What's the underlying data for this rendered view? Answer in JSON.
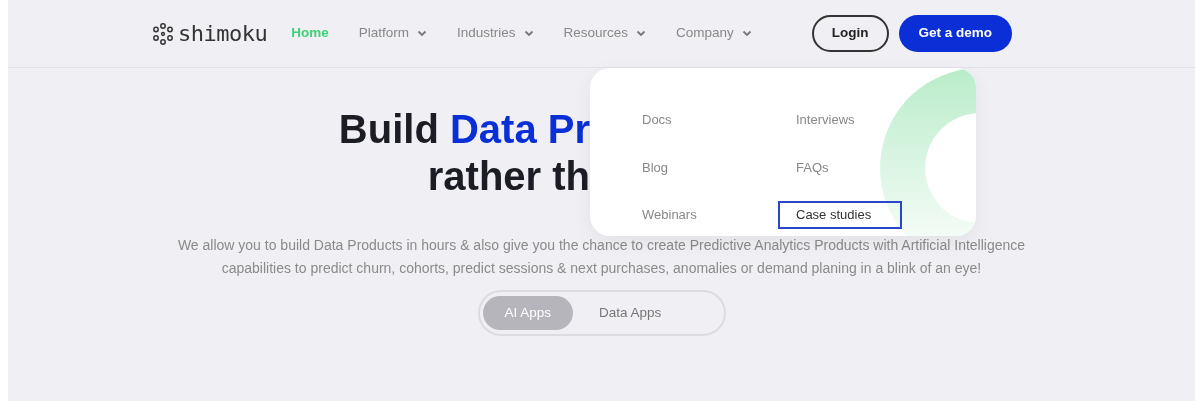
{
  "logo": {
    "text": "shimoku"
  },
  "nav": {
    "items": [
      {
        "label": "Home",
        "selected": true,
        "has_dropdown": false
      },
      {
        "label": "Platform",
        "selected": false,
        "has_dropdown": true
      },
      {
        "label": "Industries",
        "selected": false,
        "has_dropdown": true
      },
      {
        "label": "Resources",
        "selected": false,
        "has_dropdown": true
      },
      {
        "label": "Company",
        "selected": false,
        "has_dropdown": true
      }
    ],
    "buttons": [
      {
        "label": "Login",
        "kind": "outline"
      },
      {
        "label": "Get a demo",
        "kind": "primary"
      }
    ]
  },
  "hero": {
    "title_line_1": "Build",
    "title_highlight": "Data Pr",
    "title_line_2": "rather th",
    "description": "We allow you to build Data Products in hours & also give you the chance to create Predictive Analytics Products with Artificial Intelligence capabilities to predict churn, cohorts, predict sessions & next purchases, anomalies or demand planing in a blink of an eye!",
    "toggle": [
      {
        "label": "AI Apps",
        "selected": true
      },
      {
        "label": "Data Apps",
        "selected": false
      }
    ]
  },
  "resources_menu": {
    "columns": [
      [
        {
          "label": "Docs",
          "focused": false
        },
        {
          "label": "Blog",
          "focused": false
        },
        {
          "label": "Webinars",
          "focused": false
        }
      ],
      [
        {
          "label": "Interviews",
          "focused": false
        },
        {
          "label": "FAQs",
          "focused": false
        },
        {
          "label": "Case studies",
          "focused": true
        }
      ]
    ]
  }
}
